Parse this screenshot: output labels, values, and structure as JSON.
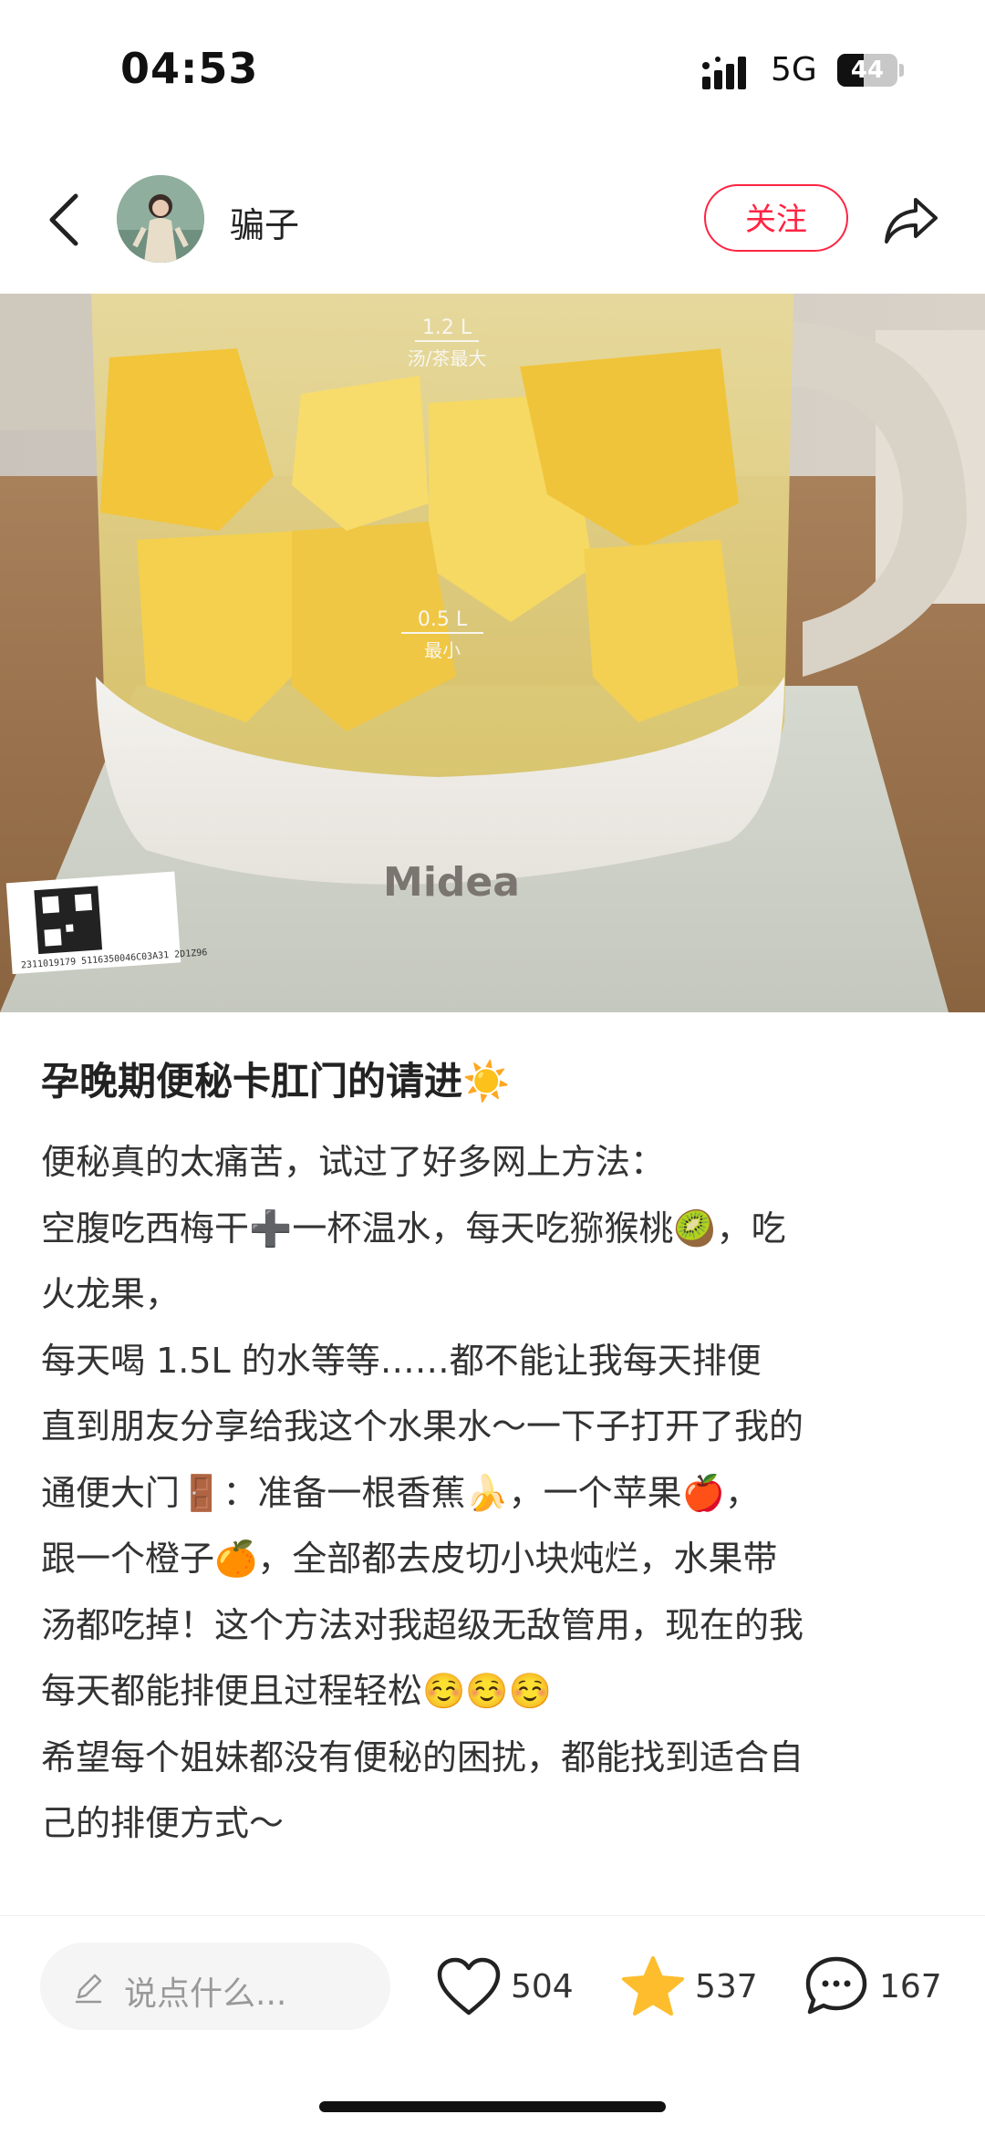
{
  "status_bar": {
    "time": "04:53",
    "network": "5G",
    "battery": "44",
    "battery_level": 0.44
  },
  "header": {
    "author_name": "骗子",
    "follow_label": "关注"
  },
  "photo": {
    "markings": [
      "1.2 L",
      "汤/茶最大",
      "0.5 L",
      "最小"
    ],
    "brand": "Midea",
    "sticker_text": "2311019179  5116350046C03A31  2D1Z96"
  },
  "post": {
    "title": "孕晚期便秘卡肛门的请进☀️",
    "lines": [
      "便秘真的太痛苦，试过了好多网上方法：",
      "空腹吃西梅干➕一杯温水，每天吃猕猴桃🥝，吃",
      "火龙果，",
      "每天喝 1.5L 的水等等……都不能让我每天排便",
      "直到朋友分享给我这个水果水～一下子打开了我的",
      "通便大门🚪：准备一根香蕉🍌，一个苹果🍎，",
      "跟一个橙子🍊，全部都去皮切小块炖烂，水果带",
      "汤都吃掉！这个方法对我超级无敌管用，现在的我",
      "每天都能排便且过程轻松☺️☺️☺️",
      "希望每个姐妹都没有便秘的困扰，都能找到适合自",
      "己的排便方式～"
    ]
  },
  "bottom_bar": {
    "comment_placeholder": "说点什么...",
    "likes": "504",
    "collects": "537",
    "comments": "167"
  },
  "colors": {
    "accent": "#ff2442",
    "star": "#fdbd2d"
  },
  "icons": [
    "back-icon",
    "share-icon",
    "pencil-icon",
    "heart-icon",
    "star-icon",
    "comment-icon"
  ]
}
